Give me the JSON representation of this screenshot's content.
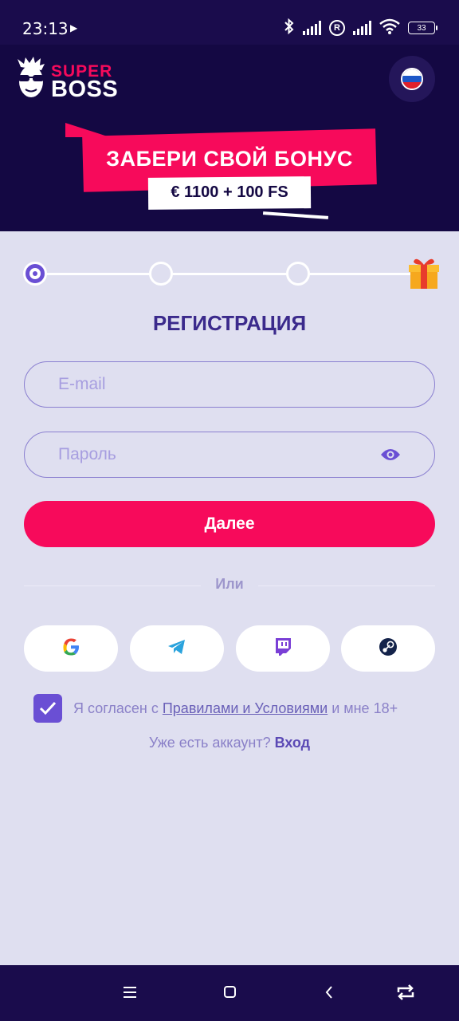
{
  "status_bar": {
    "time": "23:13",
    "battery": "33",
    "roaming": "R"
  },
  "header": {
    "logo_super": "SUPER",
    "logo_boss": "BOSS",
    "language": "ru-flag-icon"
  },
  "banner": {
    "title": "ЗАБЕРИ СВОЙ БОНУС",
    "subtitle": "€ 1100 + 100 FS"
  },
  "progress": {
    "steps_total": 3,
    "current_step": 1
  },
  "form": {
    "title": "РЕГИСТРАЦИЯ",
    "email_placeholder": "E-mail",
    "password_placeholder": "Пароль",
    "next_label": "Далее",
    "or_label": "Или"
  },
  "social": [
    "google-icon",
    "telegram-icon",
    "twitch-icon",
    "steam-icon"
  ],
  "agreement": {
    "prefix": "Я согласен с ",
    "link": "Правилами и Условиями",
    "suffix": " и мне 18+",
    "checked": true
  },
  "login": {
    "prompt": "Уже есть аккаунт? ",
    "link": "Вход"
  },
  "colors": {
    "accent": "#f70a5b",
    "primary": "#6a4fd4",
    "header_bg": "#140843",
    "page_bg": "#dfdff0"
  }
}
